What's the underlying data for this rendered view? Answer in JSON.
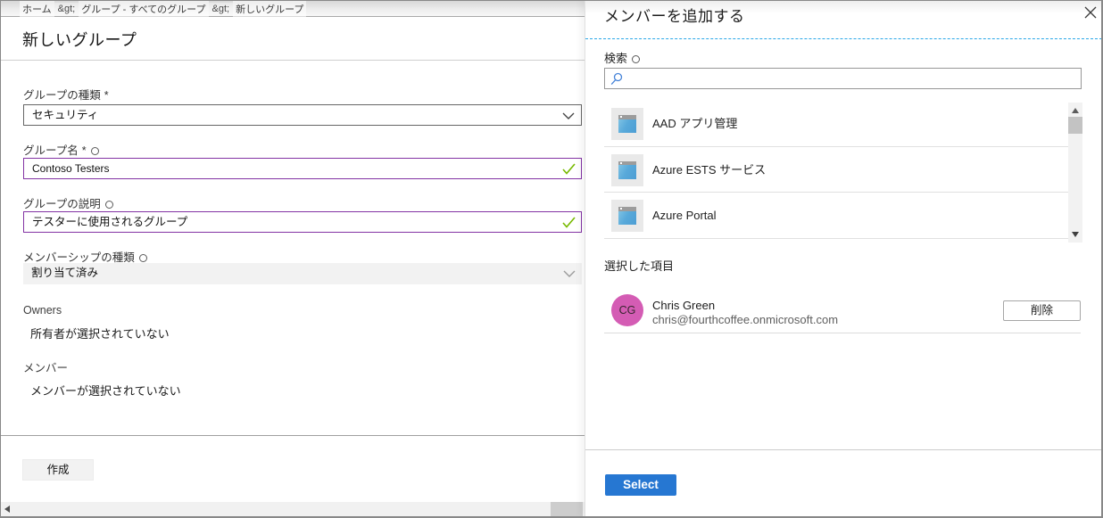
{
  "colors": {
    "accent_blue": "#2677d2",
    "dirty_purple": "#8333a4",
    "valid_green": "#77b900",
    "dashed_blue": "#2aa7e8",
    "avatar_pink": "#d45cb4"
  },
  "breadcrumb": {
    "separator": "&gt;",
    "items": [
      "ホーム",
      "グループ - すべてのグループ",
      "新しいグループ"
    ]
  },
  "page": {
    "title": "新しいグループ",
    "form": {
      "group_type": {
        "label": "グループの種類",
        "required": "*",
        "value": "セキュリティ"
      },
      "group_name": {
        "label": "グループ名",
        "required": "*",
        "value": "Contoso Testers"
      },
      "group_description": {
        "label": "グループの説明",
        "value": "テスターに使用されるグループ"
      },
      "membership_type": {
        "label": "メンバーシップの種類",
        "value": "割り当て済み"
      },
      "owners": {
        "label": "Owners",
        "empty_text": "所有者が選択されていない"
      },
      "members": {
        "label": "メンバー",
        "empty_text": "メンバーが選択されていない"
      }
    },
    "create_button": "作成"
  },
  "panel": {
    "title": "メンバーを追加する",
    "search_label": "検索",
    "search_value": "",
    "results": [
      {
        "name": "AAD アプリ管理"
      },
      {
        "name": "Azure ESTS サービス"
      },
      {
        "name": "Azure Portal"
      }
    ],
    "selected_heading": "選択した項目",
    "selected_person": {
      "initials": "CG",
      "name": "Chris Green",
      "email": "chris@fourthcoffee.onmicrosoft.com",
      "remove_button": "削除"
    },
    "select_button": "Select"
  }
}
